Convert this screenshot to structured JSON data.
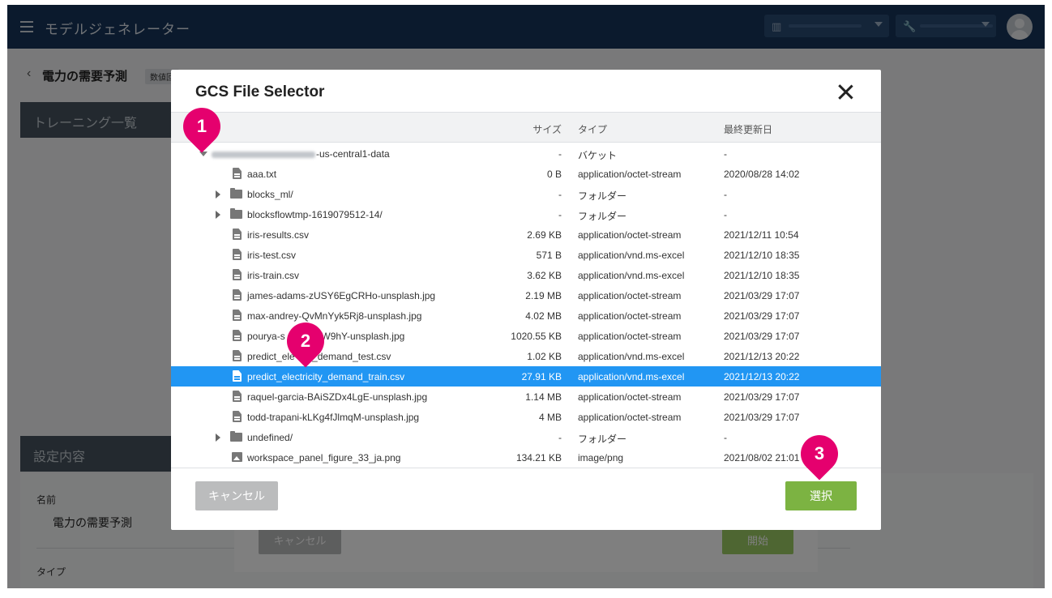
{
  "app": {
    "title": "モデルジェネレーター"
  },
  "page": {
    "title": "電力の需要予測",
    "badge": "数値回",
    "training_panel": "トレーニング一覧",
    "settings_panel": "設定内容",
    "name_label": "名前",
    "name_value": "電力の需要予測",
    "type_label": "タイプ",
    "cancel_button": "キャンセル",
    "start_button": "開始"
  },
  "modal": {
    "title": "GCS File Selector",
    "columns": {
      "name": "",
      "size": "サイズ",
      "type": "タイプ",
      "modified": "最終更新日"
    },
    "rows": [
      {
        "kind": "bucket",
        "name": "-us-central1-data",
        "size": "-",
        "type": "バケット",
        "modified": "-"
      },
      {
        "kind": "file",
        "name": "aaa.txt",
        "size": "0 B",
        "type": "application/octet-stream",
        "modified": "2020/08/28 14:02"
      },
      {
        "kind": "folder",
        "name": "blocks_ml/",
        "size": "-",
        "type": "フォルダー",
        "modified": "-"
      },
      {
        "kind": "folder",
        "name": "blocksflowtmp-1619079512-14/",
        "size": "-",
        "type": "フォルダー",
        "modified": "-"
      },
      {
        "kind": "file",
        "name": "iris-results.csv",
        "size": "2.69 KB",
        "type": "application/octet-stream",
        "modified": "2021/12/11 10:54"
      },
      {
        "kind": "file",
        "name": "iris-test.csv",
        "size": "571 B",
        "type": "application/vnd.ms-excel",
        "modified": "2021/12/10 18:35"
      },
      {
        "kind": "file",
        "name": "iris-train.csv",
        "size": "3.62 KB",
        "type": "application/vnd.ms-excel",
        "modified": "2021/12/10 18:35"
      },
      {
        "kind": "file",
        "name": "james-adams-zUSY6EgCRHo-unsplash.jpg",
        "size": "2.19 MB",
        "type": "application/octet-stream",
        "modified": "2021/03/29 17:07"
      },
      {
        "kind": "file",
        "name": "max-andrey-QvMnYyk5Rj8-unsplash.jpg",
        "size": "4.02 MB",
        "type": "application/octet-stream",
        "modified": "2021/03/29 17:07"
      },
      {
        "kind": "file",
        "name": "pourya-s           mEoM7W9hY-unsplash.jpg",
        "size": "1020.55 KB",
        "type": "application/octet-stream",
        "modified": "2021/03/29 17:07"
      },
      {
        "kind": "file",
        "name": "predict_ele        city_demand_test.csv",
        "size": "1.02 KB",
        "type": "application/vnd.ms-excel",
        "modified": "2021/12/13 20:22"
      },
      {
        "kind": "file",
        "name": "predict_electricity_demand_train.csv",
        "size": "27.91 KB",
        "type": "application/vnd.ms-excel",
        "modified": "2021/12/13 20:22",
        "selected": true
      },
      {
        "kind": "file",
        "name": "raquel-garcia-BAiSZDx4LgE-unsplash.jpg",
        "size": "1.14 MB",
        "type": "application/octet-stream",
        "modified": "2021/03/29 17:07"
      },
      {
        "kind": "file",
        "name": "todd-trapani-kLKg4fJlmqM-unsplash.jpg",
        "size": "4 MB",
        "type": "application/octet-stream",
        "modified": "2021/03/29 17:07"
      },
      {
        "kind": "folder",
        "name": "undefined/",
        "size": "-",
        "type": "フォルダー",
        "modified": "-"
      },
      {
        "kind": "image",
        "name": "workspace_panel_figure_33_ja.png",
        "size": "134.21 KB",
        "type": "image/png",
        "modified": "2021/08/02 21:01"
      }
    ],
    "cancel_button": "キャンセル",
    "select_button": "選択"
  },
  "callouts": [
    "1",
    "2",
    "3"
  ],
  "colors": {
    "header": "#16355a",
    "selected_row": "#2196f3",
    "select_button": "#7cb342",
    "callout": "#e5006e"
  }
}
